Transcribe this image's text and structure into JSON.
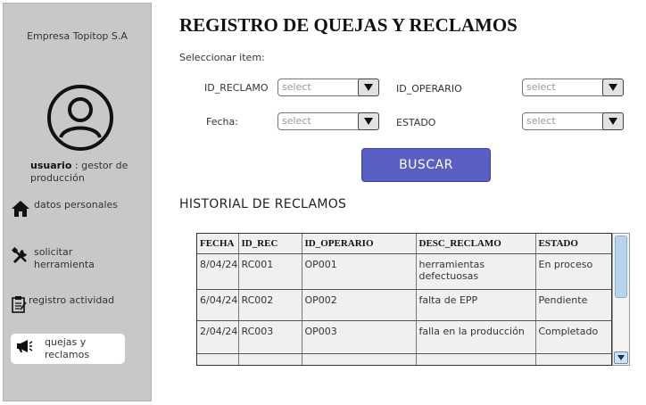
{
  "sidebar": {
    "company": "Empresa Topitop S.A",
    "user_bold": "usuario",
    "user_role": " : gestor de producción",
    "items": [
      {
        "label": "datos personales",
        "icon": "home-icon"
      },
      {
        "label": "solicitar herramienta",
        "icon": "tools-icon"
      },
      {
        "label": "registro actividad",
        "icon": "clipboard-icon"
      },
      {
        "label": "quejas y reclamos",
        "icon": "megaphone-icon"
      }
    ]
  },
  "main": {
    "title": "REGISTRO DE QUEJAS Y RECLAMOS",
    "select_item_label": "Seleccionar item:",
    "filters": {
      "id_reclamo_label": "ID_RECLAMO",
      "id_reclamo_placeholder": "select",
      "id_operario_label": "ID_OPERARIO",
      "id_operario_placeholder": "select",
      "fecha_label": "Fecha:",
      "fecha_placeholder": "select",
      "estado_label": "ESTADO",
      "estado_placeholder": "select"
    },
    "search_button": "BUSCAR",
    "history_title": "HISTORIAL DE RECLAMOS"
  },
  "table": {
    "headers": [
      "FECHA",
      "ID_REC",
      "ID_OPERARIO",
      "DESC_RECLAMO",
      "ESTADO"
    ],
    "rows": [
      [
        "8/04/24",
        "RC001",
        "OP001",
        "herramientas defectuosas",
        "En proceso"
      ],
      [
        "6/04/24",
        "RC002",
        "OP002",
        "falta de EPP",
        "Pendiente"
      ],
      [
        "2/04/24",
        "RC003",
        "OP003",
        "falla en la producción",
        "Completado"
      ]
    ]
  },
  "colors": {
    "sidebar_bg": "#c8c8c8",
    "button_bg": "#5a5fc4",
    "table_bg": "#f0f0f0"
  }
}
